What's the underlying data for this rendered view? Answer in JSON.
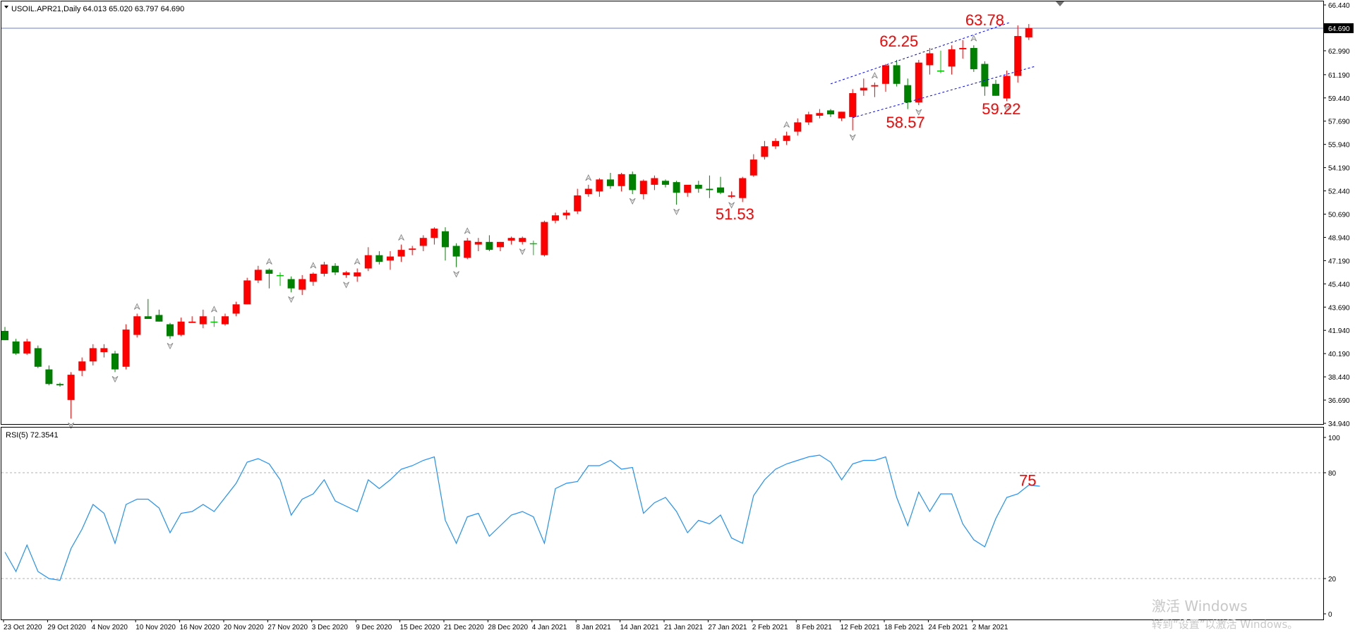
{
  "header": {
    "symbol_line": "USOIL.APR21,Daily  64.013 65.020 63.797 64.690",
    "rsi_label": "RSI(5) 72.3541"
  },
  "colors": {
    "bull": "#ff0000",
    "bear": "#008000",
    "doji": "#00c000",
    "rsi_line": "#1e90ff",
    "annotation": "#ff0000",
    "channel": "#0000ff",
    "price_line": "#6c7fbf",
    "fractal": "#808080"
  },
  "chart_data": [
    {
      "type": "candlestick",
      "title": "USOIL.APR21,Daily",
      "ohlc_current": {
        "open": 64.013,
        "high": 65.02,
        "low": 63.797,
        "close": 64.69
      },
      "current_price": 64.69,
      "current_price_label": "64.690",
      "ylim": [
        34.94,
        66.44
      ],
      "y_ticks": [
        "66.440",
        "64.690",
        "62.990",
        "61.190",
        "59.440",
        "57.690",
        "55.940",
        "54.190",
        "52.440",
        "50.690",
        "48.940",
        "47.190",
        "45.440",
        "43.690",
        "41.940",
        "40.190",
        "38.440",
        "36.690",
        "34.940"
      ],
      "y_tick_values": [
        66.44,
        64.69,
        62.99,
        61.19,
        59.44,
        57.69,
        55.94,
        54.19,
        52.44,
        50.69,
        48.94,
        47.19,
        45.44,
        43.69,
        41.94,
        40.19,
        38.44,
        36.69,
        34.94
      ],
      "x_ticks": [
        "23 Oct 2020",
        "29 Oct 2020",
        "4 Nov 2020",
        "10 Nov 2020",
        "16 Nov 2020",
        "20 Nov 2020",
        "27 Nov 2020",
        "3 Dec 2020",
        "9 Dec 2020",
        "15 Dec 2020",
        "21 Dec 2020",
        "28 Dec 2020",
        "4 Jan 2021",
        "8 Jan 2021",
        "14 Jan 2021",
        "21 Jan 2021",
        "27 Jan 2021",
        "2 Feb 2021",
        "8 Feb 2021",
        "12 Feb 2021",
        "18 Feb 2021",
        "24 Feb 2021",
        "2 Mar 2021"
      ],
      "x_tick_index": [
        0,
        4,
        8,
        12,
        16,
        20,
        24,
        28,
        32,
        36,
        40,
        44,
        48,
        52,
        56,
        60,
        64,
        68,
        72,
        76,
        80,
        84,
        88
      ],
      "candles": [
        {
          "o": 41.9,
          "h": 42.2,
          "l": 41.2,
          "c": 41.2
        },
        {
          "o": 41.1,
          "h": 41.3,
          "l": 40.1,
          "c": 40.2
        },
        {
          "o": 40.2,
          "h": 41.3,
          "l": 40.1,
          "c": 41.1
        },
        {
          "o": 40.6,
          "h": 40.8,
          "l": 39.1,
          "c": 39.2
        },
        {
          "o": 39.0,
          "h": 39.3,
          "l": 37.8,
          "c": 37.9
        },
        {
          "o": 37.9,
          "h": 38.0,
          "l": 37.7,
          "c": 37.8
        },
        {
          "o": 36.7,
          "h": 38.8,
          "l": 35.3,
          "c": 38.6
        },
        {
          "o": 38.9,
          "h": 39.9,
          "l": 38.5,
          "c": 39.6
        },
        {
          "o": 39.6,
          "h": 40.9,
          "l": 39.3,
          "c": 40.6
        },
        {
          "o": 40.3,
          "h": 40.9,
          "l": 39.9,
          "c": 40.6
        },
        {
          "o": 40.2,
          "h": 40.4,
          "l": 38.8,
          "c": 39.0
        },
        {
          "o": 39.2,
          "h": 42.4,
          "l": 39.0,
          "c": 42.0
        },
        {
          "o": 41.6,
          "h": 43.2,
          "l": 41.4,
          "c": 43.0
        },
        {
          "o": 43.0,
          "h": 44.3,
          "l": 42.8,
          "c": 42.8
        },
        {
          "o": 43.1,
          "h": 43.5,
          "l": 42.6,
          "c": 42.6
        },
        {
          "o": 42.4,
          "h": 42.5,
          "l": 41.3,
          "c": 41.5
        },
        {
          "o": 41.6,
          "h": 42.9,
          "l": 41.5,
          "c": 42.6
        },
        {
          "o": 42.5,
          "h": 43.0,
          "l": 42.5,
          "c": 42.6
        },
        {
          "o": 42.4,
          "h": 43.5,
          "l": 42.1,
          "c": 43.0
        },
        {
          "o": 42.6,
          "h": 43.0,
          "l": 42.2,
          "c": 42.6
        },
        {
          "o": 42.4,
          "h": 43.2,
          "l": 42.3,
          "c": 43.0
        },
        {
          "o": 43.2,
          "h": 44.1,
          "l": 43.0,
          "c": 43.9
        },
        {
          "o": 43.9,
          "h": 45.9,
          "l": 43.9,
          "c": 45.7
        },
        {
          "o": 45.7,
          "h": 46.8,
          "l": 45.5,
          "c": 46.5
        },
        {
          "o": 46.5,
          "h": 46.6,
          "l": 45.1,
          "c": 46.2
        },
        {
          "o": 46.1,
          "h": 46.3,
          "l": 45.3,
          "c": 46.1
        },
        {
          "o": 45.8,
          "h": 46.0,
          "l": 44.8,
          "c": 45.1
        },
        {
          "o": 45.0,
          "h": 46.1,
          "l": 44.6,
          "c": 45.8
        },
        {
          "o": 45.6,
          "h": 46.3,
          "l": 45.3,
          "c": 46.2
        },
        {
          "o": 46.2,
          "h": 47.1,
          "l": 46.0,
          "c": 46.9
        },
        {
          "o": 46.8,
          "h": 47.0,
          "l": 46.1,
          "c": 46.3
        },
        {
          "o": 46.1,
          "h": 46.4,
          "l": 45.9,
          "c": 46.3
        },
        {
          "o": 46.0,
          "h": 46.6,
          "l": 45.6,
          "c": 46.3
        },
        {
          "o": 46.6,
          "h": 48.2,
          "l": 46.4,
          "c": 47.6
        },
        {
          "o": 47.6,
          "h": 47.9,
          "l": 46.9,
          "c": 47.1
        },
        {
          "o": 47.2,
          "h": 47.9,
          "l": 46.5,
          "c": 47.5
        },
        {
          "o": 47.5,
          "h": 48.4,
          "l": 47.1,
          "c": 48.0
        },
        {
          "o": 48.0,
          "h": 48.3,
          "l": 47.6,
          "c": 48.1
        },
        {
          "o": 48.3,
          "h": 49.1,
          "l": 47.9,
          "c": 48.9
        },
        {
          "o": 48.9,
          "h": 49.7,
          "l": 48.4,
          "c": 49.6
        },
        {
          "o": 49.4,
          "h": 49.7,
          "l": 47.2,
          "c": 48.2
        },
        {
          "o": 48.3,
          "h": 48.5,
          "l": 46.7,
          "c": 47.5
        },
        {
          "o": 47.4,
          "h": 48.9,
          "l": 47.3,
          "c": 48.7
        },
        {
          "o": 48.4,
          "h": 48.9,
          "l": 47.9,
          "c": 48.6
        },
        {
          "o": 48.6,
          "h": 49.1,
          "l": 47.9,
          "c": 48.0
        },
        {
          "o": 48.2,
          "h": 48.6,
          "l": 47.9,
          "c": 48.6
        },
        {
          "o": 48.7,
          "h": 49.0,
          "l": 48.4,
          "c": 48.9
        },
        {
          "o": 48.6,
          "h": 49.0,
          "l": 48.4,
          "c": 48.9
        },
        {
          "o": 48.5,
          "h": 48.7,
          "l": 47.6,
          "c": 48.5
        },
        {
          "o": 47.6,
          "h": 50.2,
          "l": 47.5,
          "c": 50.1
        },
        {
          "o": 50.2,
          "h": 50.8,
          "l": 50.0,
          "c": 50.6
        },
        {
          "o": 50.6,
          "h": 51.0,
          "l": 50.3,
          "c": 50.8
        },
        {
          "o": 50.9,
          "h": 52.6,
          "l": 50.7,
          "c": 52.1
        },
        {
          "o": 52.2,
          "h": 52.9,
          "l": 52.0,
          "c": 52.6
        },
        {
          "o": 52.4,
          "h": 53.4,
          "l": 52.0,
          "c": 53.3
        },
        {
          "o": 53.3,
          "h": 53.8,
          "l": 52.6,
          "c": 52.8
        },
        {
          "o": 52.8,
          "h": 53.8,
          "l": 52.4,
          "c": 53.7
        },
        {
          "o": 53.7,
          "h": 53.9,
          "l": 52.2,
          "c": 52.5
        },
        {
          "o": 52.2,
          "h": 53.3,
          "l": 51.8,
          "c": 53.2
        },
        {
          "o": 52.9,
          "h": 53.6,
          "l": 52.5,
          "c": 53.4
        },
        {
          "o": 53.2,
          "h": 53.3,
          "l": 52.7,
          "c": 52.9
        },
        {
          "o": 53.1,
          "h": 53.2,
          "l": 51.4,
          "c": 52.3
        },
        {
          "o": 52.3,
          "h": 52.8,
          "l": 52.0,
          "c": 52.9
        },
        {
          "o": 52.9,
          "h": 53.2,
          "l": 52.3,
          "c": 52.6
        },
        {
          "o": 52.6,
          "h": 53.6,
          "l": 51.9,
          "c": 52.5
        },
        {
          "o": 52.7,
          "h": 53.5,
          "l": 52.2,
          "c": 52.3
        },
        {
          "o": 52.0,
          "h": 52.4,
          "l": 51.9,
          "c": 52.1
        },
        {
          "o": 51.9,
          "h": 53.5,
          "l": 51.6,
          "c": 53.4
        },
        {
          "o": 53.6,
          "h": 55.2,
          "l": 53.5,
          "c": 54.8
        },
        {
          "o": 55.0,
          "h": 56.2,
          "l": 54.8,
          "c": 55.8
        },
        {
          "o": 55.8,
          "h": 56.4,
          "l": 55.6,
          "c": 56.2
        },
        {
          "o": 56.2,
          "h": 56.9,
          "l": 55.9,
          "c": 56.6
        },
        {
          "o": 56.9,
          "h": 57.9,
          "l": 56.6,
          "c": 57.6
        },
        {
          "o": 57.6,
          "h": 58.4,
          "l": 57.4,
          "c": 58.2
        },
        {
          "o": 58.1,
          "h": 58.6,
          "l": 57.9,
          "c": 58.3
        },
        {
          "o": 58.5,
          "h": 58.6,
          "l": 58.0,
          "c": 58.2
        },
        {
          "o": 57.9,
          "h": 58.4,
          "l": 57.7,
          "c": 58.4
        },
        {
          "o": 58.0,
          "h": 60.1,
          "l": 57.0,
          "c": 59.8
        },
        {
          "o": 60.0,
          "h": 60.9,
          "l": 59.6,
          "c": 60.2
        },
        {
          "o": 60.3,
          "h": 60.6,
          "l": 59.5,
          "c": 60.4
        },
        {
          "o": 60.5,
          "h": 62.0,
          "l": 59.9,
          "c": 61.9
        },
        {
          "o": 61.9,
          "h": 62.3,
          "l": 60.3,
          "c": 60.5
        },
        {
          "o": 60.4,
          "h": 60.9,
          "l": 58.6,
          "c": 59.1
        },
        {
          "o": 59.1,
          "h": 62.3,
          "l": 58.9,
          "c": 62.1
        },
        {
          "o": 61.9,
          "h": 63.2,
          "l": 61.2,
          "c": 62.8
        },
        {
          "o": 61.5,
          "h": 63.0,
          "l": 61.3,
          "c": 61.5
        },
        {
          "o": 61.8,
          "h": 63.4,
          "l": 61.2,
          "c": 63.1
        },
        {
          "o": 63.1,
          "h": 63.8,
          "l": 62.4,
          "c": 63.2
        },
        {
          "o": 63.2,
          "h": 63.4,
          "l": 61.4,
          "c": 61.6
        },
        {
          "o": 62.0,
          "h": 62.2,
          "l": 59.6,
          "c": 60.3
        },
        {
          "o": 60.5,
          "h": 60.8,
          "l": 59.6,
          "c": 59.6
        },
        {
          "o": 59.4,
          "h": 61.5,
          "l": 59.2,
          "c": 61.1
        },
        {
          "o": 61.1,
          "h": 64.9,
          "l": 60.6,
          "c": 64.1
        },
        {
          "o": 64.0,
          "h": 65.0,
          "l": 63.8,
          "c": 64.7
        }
      ],
      "fractals_up": [
        12,
        19,
        24,
        28,
        32,
        36,
        42,
        53,
        71,
        79,
        88
      ],
      "fractals_down": [
        6,
        10,
        15,
        26,
        31,
        41,
        47,
        57,
        61,
        66,
        77,
        83,
        91
      ],
      "channel": {
        "upper": {
          "from": {
            "i": 75,
            "v": 60.5
          },
          "to": {
            "i": 91.2,
            "v": 65.1
          }
        },
        "lower": {
          "from": {
            "i": 77,
            "v": 57.95
          },
          "to": {
            "i": 93.5,
            "v": 61.8
          }
        }
      },
      "annotations": [
        {
          "text": "63.78",
          "i": 89.0,
          "v": 64.9
        },
        {
          "text": "62.25",
          "i": 81.2,
          "v": 63.3
        },
        {
          "text": "58.57",
          "i": 81.8,
          "v": 57.2
        },
        {
          "text": "59.22",
          "i": 90.5,
          "v": 58.2
        },
        {
          "text": "51.53",
          "i": 66.3,
          "v": 50.3
        }
      ]
    },
    {
      "type": "line",
      "title": "RSI(5) 72.3541",
      "indicator": "RSI(5)",
      "current_value": 72.3541,
      "ylim": [
        0,
        100
      ],
      "y_ticks": [
        "100",
        "80",
        "20",
        "0"
      ],
      "y_tick_values": [
        100,
        80,
        20,
        0
      ],
      "levels": [
        80,
        20
      ],
      "values": [
        35,
        24,
        39,
        24,
        20,
        19,
        37,
        48,
        62,
        57,
        40,
        62,
        65,
        65,
        60,
        46,
        57,
        58,
        62,
        58,
        66,
        74,
        86,
        88,
        85,
        76,
        56,
        65,
        68,
        76,
        64,
        61,
        58,
        76,
        71,
        76,
        82,
        84,
        87,
        89,
        53,
        40,
        55,
        57,
        44,
        50,
        56,
        58,
        55,
        40,
        71,
        74,
        75,
        84,
        84,
        87,
        82,
        83,
        57,
        63,
        66,
        58,
        46,
        53,
        51,
        56,
        43,
        40,
        67,
        76,
        82,
        85,
        87,
        89,
        90,
        86,
        76,
        85,
        87,
        87,
        89,
        66,
        50,
        69,
        58,
        68,
        68,
        51,
        42,
        38,
        54,
        66,
        68,
        73,
        72.35
      ],
      "annotations": [
        {
          "text": "75",
          "i": 92.0,
          "v": 75
        }
      ]
    }
  ],
  "footer": {
    "watermark_line1": "激活 Windows",
    "watermark_line2": "转到“设置”以激活 Windows。"
  }
}
